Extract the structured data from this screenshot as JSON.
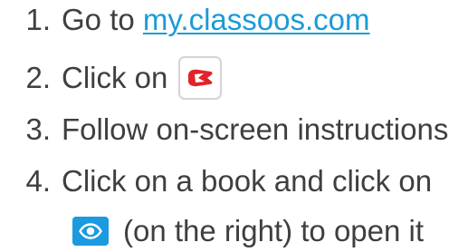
{
  "steps": [
    {
      "number": "1.",
      "text": "Go to ",
      "link": "my.classoos.com"
    },
    {
      "number": "2.",
      "text": "Click on",
      "icon": "classoos-logo-icon"
    },
    {
      "number": "3.",
      "text": "Follow on-screen instructions"
    },
    {
      "number": "4.",
      "text": "Click on a book and click on"
    }
  ],
  "continuation": {
    "icon": "eye-icon",
    "text": "(on the right) to open it"
  },
  "colors": {
    "text": "#3f3f3f",
    "link": "#1a9bd7",
    "logo_red": "#e0242b",
    "eye_button": "#1b9ae0"
  }
}
